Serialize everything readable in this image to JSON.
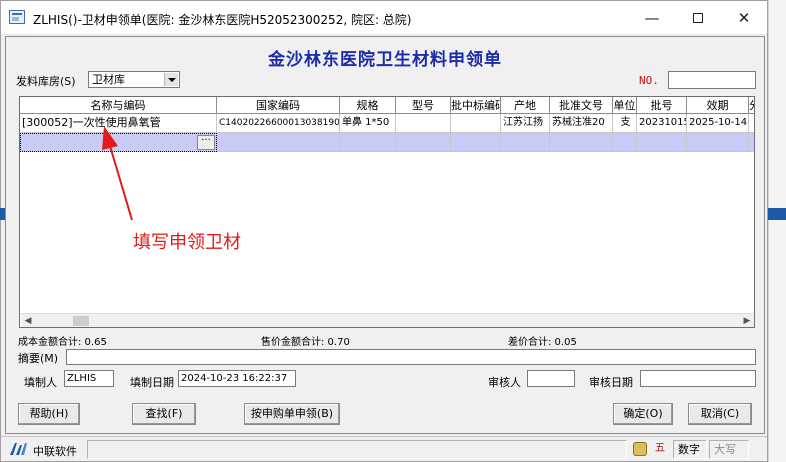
{
  "window": {
    "title": "ZLHIS()-卫材申领单(医院: 金沙林东医院H52052300252,  院区: 总院)",
    "minimize": "—",
    "maximize": "",
    "close": "✕"
  },
  "page_title": "金沙林东医院卫生材料申领单",
  "warehouse": {
    "label": "发料库房(S)",
    "value": "卫材库"
  },
  "no_label": "NO.",
  "grid": {
    "headers": [
      "名称与编码",
      "国家编码",
      "规格",
      "型号",
      "批中标编码",
      "产地",
      "批准文号",
      "单位",
      "批号",
      "效期",
      "分"
    ],
    "rows": [
      [
        "[300052]一次性使用鼻氧管",
        "C14020226600013038190",
        "单鼻 1*50",
        "",
        "",
        "江苏江扬",
        "苏械注准20",
        "支",
        "20231015",
        "2025-10-14",
        ""
      ]
    ],
    "ellipsis": "···"
  },
  "totals": {
    "cost": "成本金额合计: 0.65",
    "sale": "售价金额合计: 0.70",
    "diff": "差价合计: 0.05"
  },
  "memo_label": "摘要(M)",
  "filler": {
    "label": "填制人",
    "value": "ZLHIS"
  },
  "fill_date": {
    "label": "填制日期",
    "value": "2024-10-23 16:22:37"
  },
  "reviewer": {
    "label": "审核人"
  },
  "review_date": {
    "label": "审核日期"
  },
  "buttons": {
    "help": "帮助(H)",
    "find": "查找(F)",
    "by_purchase": "按申购单申领(B)",
    "ok": "确定(O)",
    "cancel": "取消(C)"
  },
  "status": {
    "company": "中联软件",
    "digits": "数字",
    "caps": "大写",
    "ime": "五"
  },
  "annotation": {
    "text": "填写申领卫材",
    "color": "#e11b1b"
  }
}
